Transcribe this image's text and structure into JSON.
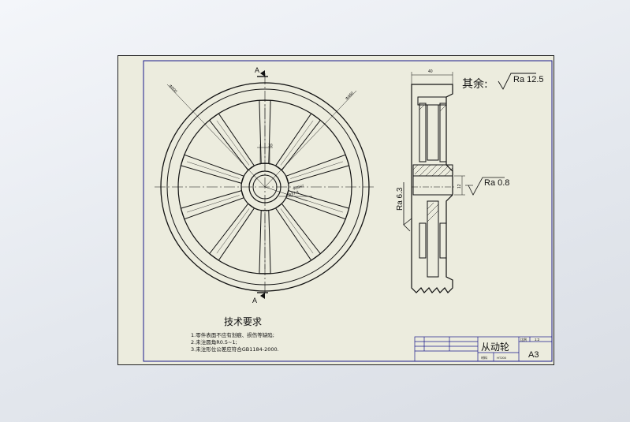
{
  "sheet": {
    "paper_color": "#ececde",
    "frame_color": "#1a1a8c",
    "line_color": "#111111"
  },
  "front_view": {
    "section_mark": "A",
    "dim_left": "Φ500",
    "dim_right": "Φ460",
    "dim_keyway": "10",
    "dim_bore": "Φ37.3",
    "dim_bore_fit": "Φ35H7"
  },
  "side_view": {
    "dim_width": "40",
    "dim_hub": "12",
    "roughness_hub": "Ra 0.8",
    "roughness_face": "Ra 6.3"
  },
  "roughness_general": {
    "prefix": "其余:",
    "value": "Ra 12.5"
  },
  "tech_requirements": {
    "title": "技术要求",
    "items": [
      "1.零件表面不应有划痕、损伤等缺陷;",
      "2.未注圆角R0.5~1;",
      "3.未注形位公差应符合GB1184-2000."
    ]
  },
  "title_block": {
    "part_name": "从动轮",
    "sheet_size": "A3",
    "scale_label": "比例",
    "scale": "1:2",
    "material_label": "材料",
    "material": "HT200"
  }
}
